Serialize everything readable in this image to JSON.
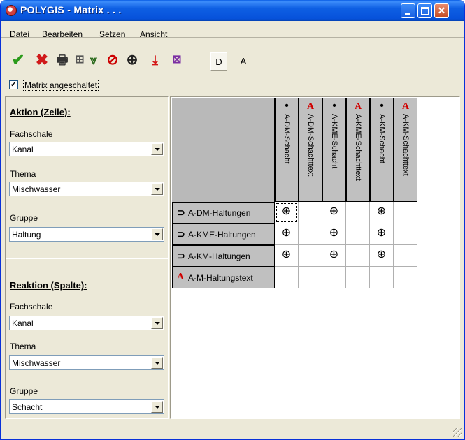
{
  "window": {
    "title": "POLYGIS - Matrix . . ."
  },
  "menu": [
    {
      "key": "D",
      "rest": "atei"
    },
    {
      "key": "B",
      "rest": "earbeiten"
    },
    {
      "key": "S",
      "rest": "etzen"
    },
    {
      "key": "A",
      "rest": "nsicht"
    }
  ],
  "toolbar": {
    "ok_glyph": "✔",
    "cancel_glyph": "✖",
    "print_glyph": "🖶",
    "tree_glyph": "⊞",
    "funnel_glyph": "⩔",
    "stop_glyph": "⊘",
    "target_glyph": "⊕",
    "down_glyph": "⤓",
    "grid_glyph": "⊠",
    "d_label": "D",
    "a_label": "A"
  },
  "matrix_toggle": {
    "label": "Matrix angeschaltet",
    "checked": "✓"
  },
  "left": {
    "action": {
      "title": "Aktion (Zeile):",
      "fachschale_label": "Fachschale",
      "fachschale_value": "Kanal",
      "thema_label": "Thema",
      "thema_value": "Mischwasser",
      "gruppe_label": "Gruppe",
      "gruppe_value": "Haltung"
    },
    "reaction": {
      "title": "Reaktion (Spalte):",
      "fachschale_label": "Fachschale",
      "fachschale_value": "Kanal",
      "thema_label": "Thema",
      "thema_value": "Mischwasser",
      "gruppe_label": "Gruppe",
      "gruppe_value": "Schacht"
    }
  },
  "matrix": {
    "columns": [
      {
        "label": "A-DM-Schacht",
        "icon": "•",
        "kind": "dot"
      },
      {
        "label": "A-DM-Schachttext",
        "icon": "A",
        "kind": "red-a"
      },
      {
        "label": "A-KME-Schacht",
        "icon": "•",
        "kind": "dot"
      },
      {
        "label": "A-KME-Schachttext",
        "icon": "A",
        "kind": "red-a"
      },
      {
        "label": "A-KM-Schacht",
        "icon": "•",
        "kind": "dot"
      },
      {
        "label": "A-KM-Schachttext",
        "icon": "A",
        "kind": "red-a"
      }
    ],
    "rows": [
      {
        "label": "A-DM-Haltungen",
        "icon": "⊃",
        "kind": "line",
        "cells": [
          "⊕",
          "",
          "⊕",
          "",
          "⊕",
          ""
        ]
      },
      {
        "label": "A-KME-Haltungen",
        "icon": "⊃",
        "kind": "line",
        "cells": [
          "⊕",
          "",
          "⊕",
          "",
          "⊕",
          ""
        ]
      },
      {
        "label": "A-KM-Haltungen",
        "icon": "⊃",
        "kind": "line",
        "cells": [
          "⊕",
          "",
          "⊕",
          "",
          "⊕",
          ""
        ]
      },
      {
        "label": "A-M-Haltungstext",
        "icon": "A",
        "kind": "red-a",
        "cells": [
          "",
          "",
          "",
          "",
          "",
          ""
        ]
      }
    ]
  }
}
